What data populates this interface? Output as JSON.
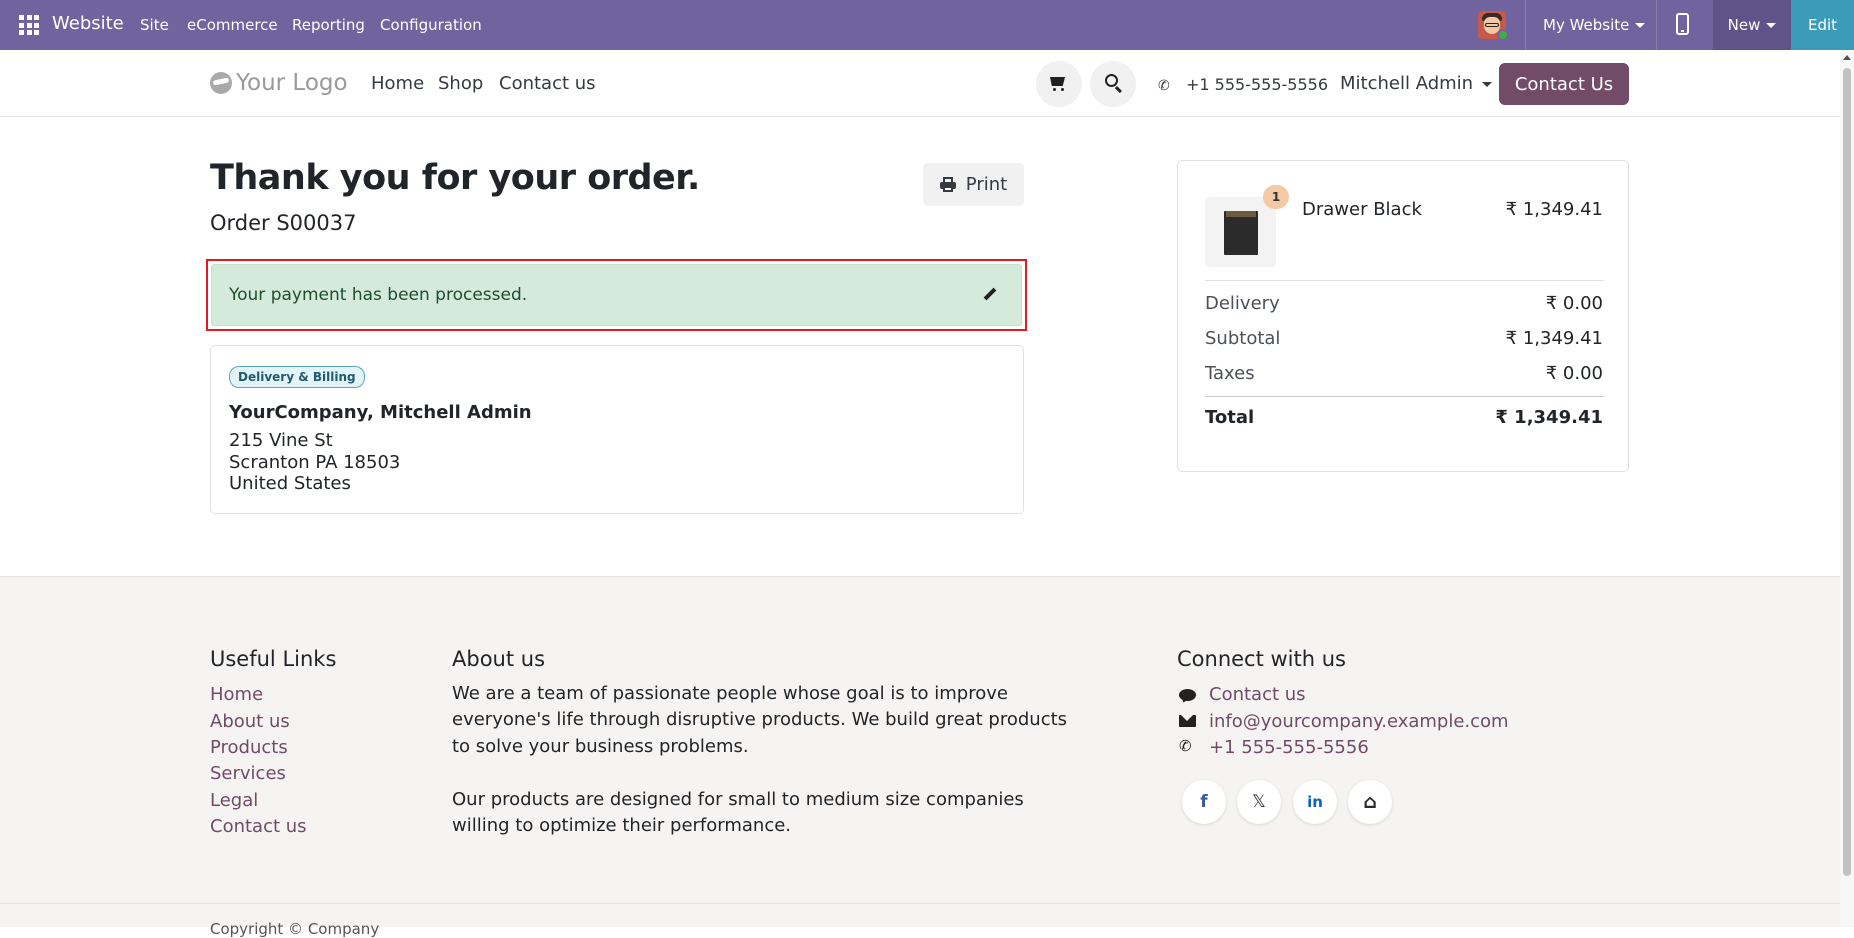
{
  "topbar": {
    "app_name": "Website",
    "menus": [
      "Site",
      "eCommerce",
      "Reporting",
      "Configuration"
    ],
    "website_selector": "My Website",
    "new_label": "New",
    "edit_label": "Edit",
    "color": "#71639e",
    "edit_color": "#3c9bb9"
  },
  "header": {
    "logo_text": "Your Logo",
    "nav": [
      "Home",
      "Shop",
      "Contact us"
    ],
    "phone": "+1 555-555-5556",
    "user": "Mitchell Admin",
    "contact_button": "Contact Us",
    "contact_button_color": "#714b67"
  },
  "main": {
    "title": "Thank you for your order.",
    "order": "Order S00037",
    "print_label": "Print",
    "alert_text": "Your payment has been processed.",
    "address": {
      "badge": "Delivery & Billing",
      "name": "YourCompany, Mitchell Admin",
      "line1": "215 Vine St",
      "line2": "Scranton PA 18503",
      "line3": "United States"
    }
  },
  "summary": {
    "product": {
      "name": "Drawer Black",
      "quantity": "1",
      "price": "₹ 1,349.41"
    },
    "rows": [
      {
        "label": "Delivery",
        "value": "₹ 0.00"
      },
      {
        "label": "Subtotal",
        "value": "₹ 1,349.41"
      },
      {
        "label": "Taxes",
        "value": "₹ 0.00"
      }
    ],
    "total_label": "Total",
    "total_value": "₹ 1,349.41"
  },
  "footer": {
    "useful_links_heading": "Useful Links",
    "useful_links": [
      "Home",
      "About us",
      "Products",
      "Services",
      "Legal",
      "Contact us"
    ],
    "about_heading": "About us",
    "about_p1_lines": [
      "We are a team of passionate people whose goal is to improve",
      "everyone's life through disruptive products. We build great products",
      "to solve your business problems."
    ],
    "about_p2_lines": [
      "Our products are designed for small to medium size companies",
      "willing to optimize their performance."
    ],
    "connect_heading": "Connect with us",
    "connect_items": [
      "Contact us",
      "info@yourcompany.example.com",
      "+1 555-555-5556"
    ],
    "social": [
      "f",
      "𝕏",
      "in",
      "⌂"
    ],
    "copyright": "Copyright © Company"
  }
}
